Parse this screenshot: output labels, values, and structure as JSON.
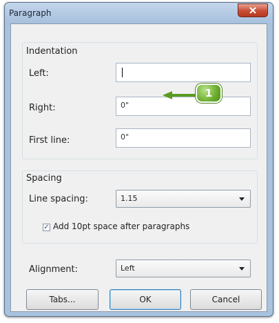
{
  "window": {
    "title": "Paragraph"
  },
  "indentation": {
    "group_label": "Indentation",
    "left_label": "Left:",
    "left_value": "",
    "right_label": "Right:",
    "right_value": "0\"",
    "first_line_label": "First line:",
    "first_line_value": "0\""
  },
  "spacing": {
    "group_label": "Spacing",
    "line_spacing_label": "Line spacing:",
    "line_spacing_value": "1.15",
    "add_space_label": "Add 10pt space after paragraphs",
    "add_space_checked": true
  },
  "alignment": {
    "label": "Alignment:",
    "value": "Left"
  },
  "buttons": {
    "tabs": "Tabs...",
    "ok": "OK",
    "cancel": "Cancel"
  },
  "callout": {
    "number": "1",
    "color": "#6cae2e"
  },
  "colors": {
    "close_button": "#c74c34",
    "title_bar": "#a9c2de"
  }
}
